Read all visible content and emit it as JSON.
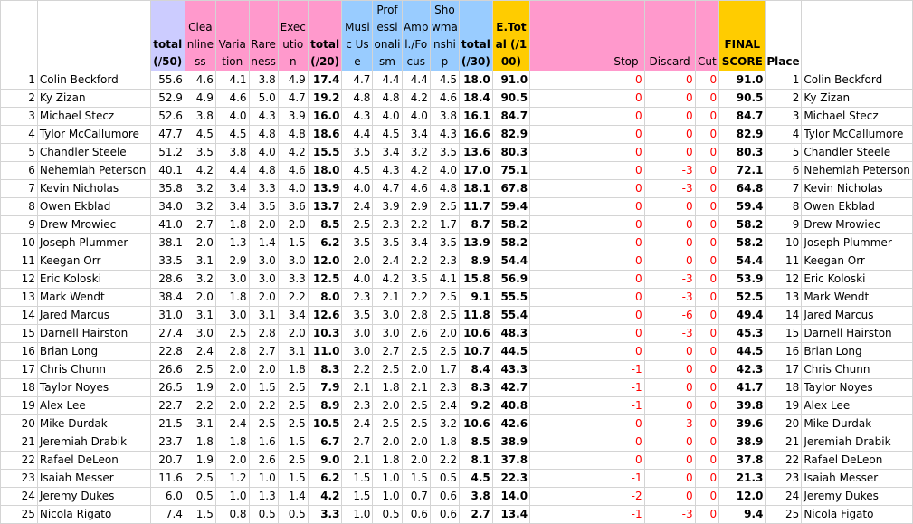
{
  "headers": {
    "total50": "total (/50)",
    "cleanliness": "Cleanliness",
    "variation": "Variation",
    "rareness": "Rareness",
    "execution": "Execution",
    "total20": "total (/20)",
    "music_use": "Music Use",
    "professionalism": "Professionalism",
    "ampl_focus": "Ampl./Focus",
    "showmanship": "Showmanship",
    "total30": "total (/30)",
    "etotal": "E.Total (/100)",
    "stop": "Stop",
    "discard": "Discard",
    "cut": "Cut",
    "final_score": "FINAL SCORE",
    "place": "Place"
  },
  "rows": [
    {
      "rank": "1",
      "name": "Colin Beckford",
      "t50": "55.6",
      "cl": "4.6",
      "va": "4.1",
      "ra": "3.8",
      "ex": "4.9",
      "t20": "17.4",
      "mu": "4.7",
      "pr": "4.4",
      "am": "4.4",
      "sh": "4.5",
      "t30": "18.0",
      "et": "91.0",
      "stop": "0",
      "disc": "0",
      "cut": "0",
      "final": "91.0",
      "place": "1",
      "name2": "Colin Beckford"
    },
    {
      "rank": "2",
      "name": "Ky Zizan",
      "t50": "52.9",
      "cl": "4.9",
      "va": "4.6",
      "ra": "5.0",
      "ex": "4.7",
      "t20": "19.2",
      "mu": "4.8",
      "pr": "4.8",
      "am": "4.2",
      "sh": "4.6",
      "t30": "18.4",
      "et": "90.5",
      "stop": "0",
      "disc": "0",
      "cut": "0",
      "final": "90.5",
      "place": "2",
      "name2": "Ky Zizan"
    },
    {
      "rank": "3",
      "name": "Michael Stecz",
      "t50": "52.6",
      "cl": "3.8",
      "va": "4.0",
      "ra": "4.3",
      "ex": "3.9",
      "t20": "16.0",
      "mu": "4.3",
      "pr": "4.0",
      "am": "4.0",
      "sh": "3.8",
      "t30": "16.1",
      "et": "84.7",
      "stop": "0",
      "disc": "0",
      "cut": "0",
      "final": "84.7",
      "place": "3",
      "name2": "Michael Stecz"
    },
    {
      "rank": "4",
      "name": "Tylor McCallumore",
      "t50": "47.7",
      "cl": "4.5",
      "va": "4.5",
      "ra": "4.8",
      "ex": "4.8",
      "t20": "18.6",
      "mu": "4.4",
      "pr": "4.5",
      "am": "3.4",
      "sh": "4.3",
      "t30": "16.6",
      "et": "82.9",
      "stop": "0",
      "disc": "0",
      "cut": "0",
      "final": "82.9",
      "place": "4",
      "name2": "Tylor McCallumore"
    },
    {
      "rank": "5",
      "name": "Chandler Steele",
      "t50": "51.2",
      "cl": "3.5",
      "va": "3.8",
      "ra": "4.0",
      "ex": "4.2",
      "t20": "15.5",
      "mu": "3.5",
      "pr": "3.4",
      "am": "3.2",
      "sh": "3.5",
      "t30": "13.6",
      "et": "80.3",
      "stop": "0",
      "disc": "0",
      "cut": "0",
      "final": "80.3",
      "place": "5",
      "name2": "Chandler Steele"
    },
    {
      "rank": "6",
      "name": "Nehemiah Peterson",
      "t50": "40.1",
      "cl": "4.2",
      "va": "4.4",
      "ra": "4.8",
      "ex": "4.6",
      "t20": "18.0",
      "mu": "4.5",
      "pr": "4.3",
      "am": "4.2",
      "sh": "4.0",
      "t30": "17.0",
      "et": "75.1",
      "stop": "0",
      "disc": "-3",
      "cut": "0",
      "final": "72.1",
      "place": "6",
      "name2": "Nehemiah Peterson"
    },
    {
      "rank": "7",
      "name": "Kevin Nicholas",
      "t50": "35.8",
      "cl": "3.2",
      "va": "3.4",
      "ra": "3.3",
      "ex": "4.0",
      "t20": "13.9",
      "mu": "4.0",
      "pr": "4.7",
      "am": "4.6",
      "sh": "4.8",
      "t30": "18.1",
      "et": "67.8",
      "stop": "0",
      "disc": "-3",
      "cut": "0",
      "final": "64.8",
      "place": "7",
      "name2": "Kevin Nicholas"
    },
    {
      "rank": "8",
      "name": "Owen Ekblad",
      "t50": "34.0",
      "cl": "3.2",
      "va": "3.4",
      "ra": "3.5",
      "ex": "3.6",
      "t20": "13.7",
      "mu": "2.4",
      "pr": "3.9",
      "am": "2.9",
      "sh": "2.5",
      "t30": "11.7",
      "et": "59.4",
      "stop": "0",
      "disc": "0",
      "cut": "0",
      "final": "59.4",
      "place": "8",
      "name2": "Owen Ekblad"
    },
    {
      "rank": "9",
      "name": "Drew Mrowiec",
      "t50": "41.0",
      "cl": "2.7",
      "va": "1.8",
      "ra": "2.0",
      "ex": "2.0",
      "t20": "8.5",
      "mu": "2.5",
      "pr": "2.3",
      "am": "2.2",
      "sh": "1.7",
      "t30": "8.7",
      "et": "58.2",
      "stop": "0",
      "disc": "0",
      "cut": "0",
      "final": "58.2",
      "place": "9",
      "name2": "Drew Mrowiec"
    },
    {
      "rank": "10",
      "name": "Joseph Plummer",
      "t50": "38.1",
      "cl": "2.0",
      "va": "1.3",
      "ra": "1.4",
      "ex": "1.5",
      "t20": "6.2",
      "mu": "3.5",
      "pr": "3.5",
      "am": "3.4",
      "sh": "3.5",
      "t30": "13.9",
      "et": "58.2",
      "stop": "0",
      "disc": "0",
      "cut": "0",
      "final": "58.2",
      "place": "10",
      "name2": "Joseph Plummer"
    },
    {
      "rank": "11",
      "name": "Keegan Orr",
      "t50": "33.5",
      "cl": "3.1",
      "va": "2.9",
      "ra": "3.0",
      "ex": "3.0",
      "t20": "12.0",
      "mu": "2.0",
      "pr": "2.4",
      "am": "2.2",
      "sh": "2.3",
      "t30": "8.9",
      "et": "54.4",
      "stop": "0",
      "disc": "0",
      "cut": "0",
      "final": "54.4",
      "place": "11",
      "name2": "Keegan Orr"
    },
    {
      "rank": "12",
      "name": "Eric Koloski",
      "t50": "28.6",
      "cl": "3.2",
      "va": "3.0",
      "ra": "3.0",
      "ex": "3.3",
      "t20": "12.5",
      "mu": "4.0",
      "pr": "4.2",
      "am": "3.5",
      "sh": "4.1",
      "t30": "15.8",
      "et": "56.9",
      "stop": "0",
      "disc": "-3",
      "cut": "0",
      "final": "53.9",
      "place": "12",
      "name2": "Eric Koloski"
    },
    {
      "rank": "13",
      "name": "Mark Wendt",
      "t50": "38.4",
      "cl": "2.0",
      "va": "1.8",
      "ra": "2.0",
      "ex": "2.2",
      "t20": "8.0",
      "mu": "2.3",
      "pr": "2.1",
      "am": "2.2",
      "sh": "2.5",
      "t30": "9.1",
      "et": "55.5",
      "stop": "0",
      "disc": "-3",
      "cut": "0",
      "final": "52.5",
      "place": "13",
      "name2": "Mark Wendt"
    },
    {
      "rank": "14",
      "name": "Jared Marcus",
      "t50": "31.0",
      "cl": "3.1",
      "va": "3.0",
      "ra": "3.1",
      "ex": "3.4",
      "t20": "12.6",
      "mu": "3.5",
      "pr": "3.0",
      "am": "2.8",
      "sh": "2.5",
      "t30": "11.8",
      "et": "55.4",
      "stop": "0",
      "disc": "-6",
      "cut": "0",
      "final": "49.4",
      "place": "14",
      "name2": "Jared Marcus"
    },
    {
      "rank": "15",
      "name": "Darnell Hairston",
      "t50": "27.4",
      "cl": "3.0",
      "va": "2.5",
      "ra": "2.8",
      "ex": "2.0",
      "t20": "10.3",
      "mu": "3.0",
      "pr": "3.0",
      "am": "2.6",
      "sh": "2.0",
      "t30": "10.6",
      "et": "48.3",
      "stop": "0",
      "disc": "-3",
      "cut": "0",
      "final": "45.3",
      "place": "15",
      "name2": "Darnell Hairston"
    },
    {
      "rank": "16",
      "name": "Brian Long",
      "t50": "22.8",
      "cl": "2.4",
      "va": "2.8",
      "ra": "2.7",
      "ex": "3.1",
      "t20": "11.0",
      "mu": "3.0",
      "pr": "2.7",
      "am": "2.5",
      "sh": "2.5",
      "t30": "10.7",
      "et": "44.5",
      "stop": "0",
      "disc": "0",
      "cut": "0",
      "final": "44.5",
      "place": "16",
      "name2": "Brian Long"
    },
    {
      "rank": "17",
      "name": "Chris Chunn",
      "t50": "26.6",
      "cl": "2.5",
      "va": "2.0",
      "ra": "2.0",
      "ex": "1.8",
      "t20": "8.3",
      "mu": "2.2",
      "pr": "2.5",
      "am": "2.0",
      "sh": "1.7",
      "t30": "8.4",
      "et": "43.3",
      "stop": "-1",
      "disc": "0",
      "cut": "0",
      "final": "42.3",
      "place": "17",
      "name2": "Chris Chunn"
    },
    {
      "rank": "18",
      "name": "Taylor Noyes",
      "t50": "26.5",
      "cl": "1.9",
      "va": "2.0",
      "ra": "1.5",
      "ex": "2.5",
      "t20": "7.9",
      "mu": "2.1",
      "pr": "1.8",
      "am": "2.1",
      "sh": "2.3",
      "t30": "8.3",
      "et": "42.7",
      "stop": "-1",
      "disc": "0",
      "cut": "0",
      "final": "41.7",
      "place": "18",
      "name2": "Taylor Noyes"
    },
    {
      "rank": "19",
      "name": "Alex Lee",
      "t50": "22.7",
      "cl": "2.2",
      "va": "2.0",
      "ra": "2.2",
      "ex": "2.5",
      "t20": "8.9",
      "mu": "2.3",
      "pr": "2.0",
      "am": "2.5",
      "sh": "2.4",
      "t30": "9.2",
      "et": "40.8",
      "stop": "-1",
      "disc": "0",
      "cut": "0",
      "final": "39.8",
      "place": "19",
      "name2": "Alex Lee"
    },
    {
      "rank": "20",
      "name": "Mike Durdak",
      "t50": "21.5",
      "cl": "3.1",
      "va": "2.4",
      "ra": "2.5",
      "ex": "2.5",
      "t20": "10.5",
      "mu": "2.4",
      "pr": "2.5",
      "am": "2.5",
      "sh": "3.2",
      "t30": "10.6",
      "et": "42.6",
      "stop": "0",
      "disc": "-3",
      "cut": "0",
      "final": "39.6",
      "place": "20",
      "name2": "Mike Durdak"
    },
    {
      "rank": "21",
      "name": "Jeremiah Drabik",
      "t50": "23.7",
      "cl": "1.8",
      "va": "1.8",
      "ra": "1.6",
      "ex": "1.5",
      "t20": "6.7",
      "mu": "2.7",
      "pr": "2.0",
      "am": "2.0",
      "sh": "1.8",
      "t30": "8.5",
      "et": "38.9",
      "stop": "0",
      "disc": "0",
      "cut": "0",
      "final": "38.9",
      "place": "21",
      "name2": "Jeremiah Drabik"
    },
    {
      "rank": "22",
      "name": "Rafael DeLeon",
      "t50": "20.7",
      "cl": "1.9",
      "va": "2.0",
      "ra": "2.6",
      "ex": "2.5",
      "t20": "9.0",
      "mu": "2.1",
      "pr": "1.8",
      "am": "2.0",
      "sh": "2.2",
      "t30": "8.1",
      "et": "37.8",
      "stop": "0",
      "disc": "0",
      "cut": "0",
      "final": "37.8",
      "place": "22",
      "name2": "Rafael DeLeon"
    },
    {
      "rank": "23",
      "name": "Isaiah Messer",
      "t50": "11.6",
      "cl": "2.5",
      "va": "1.2",
      "ra": "1.0",
      "ex": "1.5",
      "t20": "6.2",
      "mu": "1.5",
      "pr": "1.0",
      "am": "1.5",
      "sh": "0.5",
      "t30": "4.5",
      "et": "22.3",
      "stop": "-1",
      "disc": "0",
      "cut": "0",
      "final": "21.3",
      "place": "23",
      "name2": "Isaiah Messer"
    },
    {
      "rank": "24",
      "name": "Jeremy Dukes",
      "t50": "6.0",
      "cl": "0.5",
      "va": "1.0",
      "ra": "1.3",
      "ex": "1.4",
      "t20": "4.2",
      "mu": "1.5",
      "pr": "1.0",
      "am": "0.7",
      "sh": "0.6",
      "t30": "3.8",
      "et": "14.0",
      "stop": "-2",
      "disc": "0",
      "cut": "0",
      "final": "12.0",
      "place": "24",
      "name2": "Jeremy Dukes"
    },
    {
      "rank": "25",
      "name": "Nicola Rigato",
      "t50": "7.4",
      "cl": "1.5",
      "va": "0.8",
      "ra": "0.5",
      "ex": "0.5",
      "t20": "3.3",
      "mu": "1.0",
      "pr": "0.5",
      "am": "0.6",
      "sh": "0.6",
      "t30": "2.7",
      "et": "13.4",
      "stop": "-1",
      "disc": "-3",
      "cut": "0",
      "final": "9.4",
      "place": "25",
      "name2": "Nicola Figato"
    }
  ]
}
